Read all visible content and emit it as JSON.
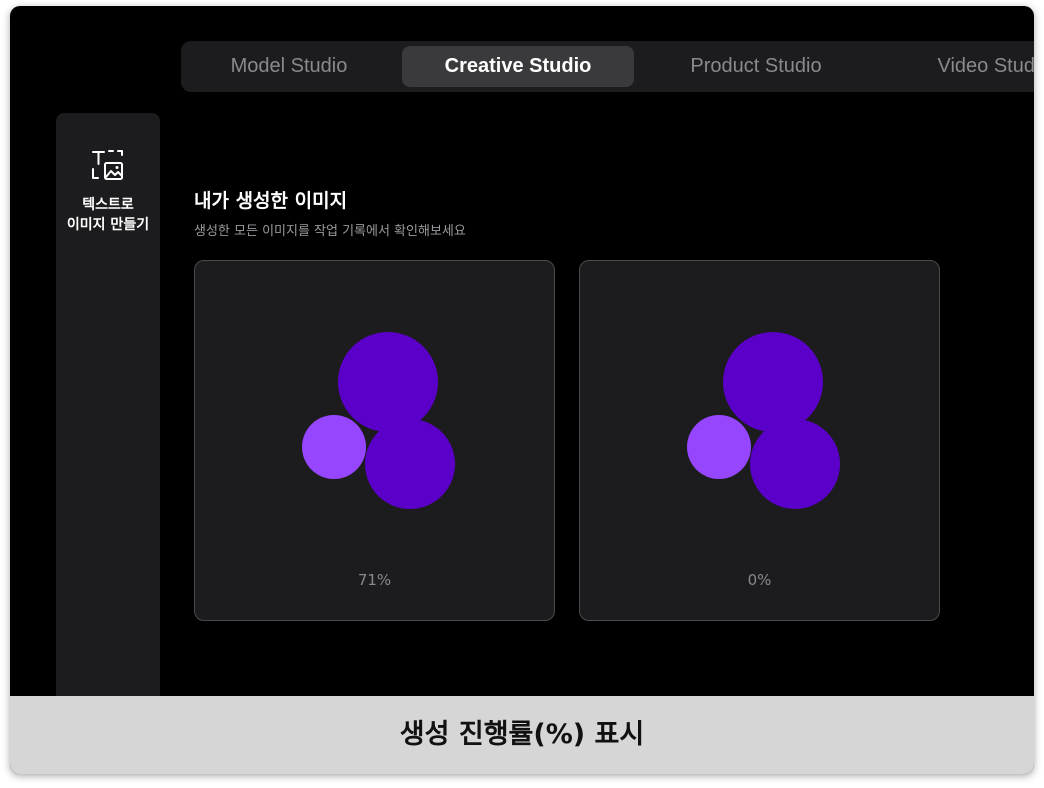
{
  "tabs": [
    {
      "label": "Model Studio",
      "active": false
    },
    {
      "label": "Creative Studio",
      "active": true
    },
    {
      "label": "Product Studio",
      "active": false
    },
    {
      "label": "Video Studio",
      "active": false
    }
  ],
  "sidebar": {
    "items": [
      {
        "label": "텍스트로\n이미지 만들기",
        "icon": "text-to-image-icon"
      }
    ]
  },
  "section": {
    "title": "내가 생성한 이미지",
    "subtitle": "생성한 모든 이미지를 작업 기록에서 확인해보세요"
  },
  "cards": [
    {
      "progress_label": "71%",
      "progress": 71
    },
    {
      "progress_label": "0%",
      "progress": 0
    }
  ],
  "caption": "생성 진행률(%) 표시",
  "colors": {
    "background": "#000000",
    "panel": "#1c1c1e",
    "active_tab": "#3a3a3c",
    "blob_dark": "#5b00c9",
    "blob_light": "#9646ff"
  }
}
